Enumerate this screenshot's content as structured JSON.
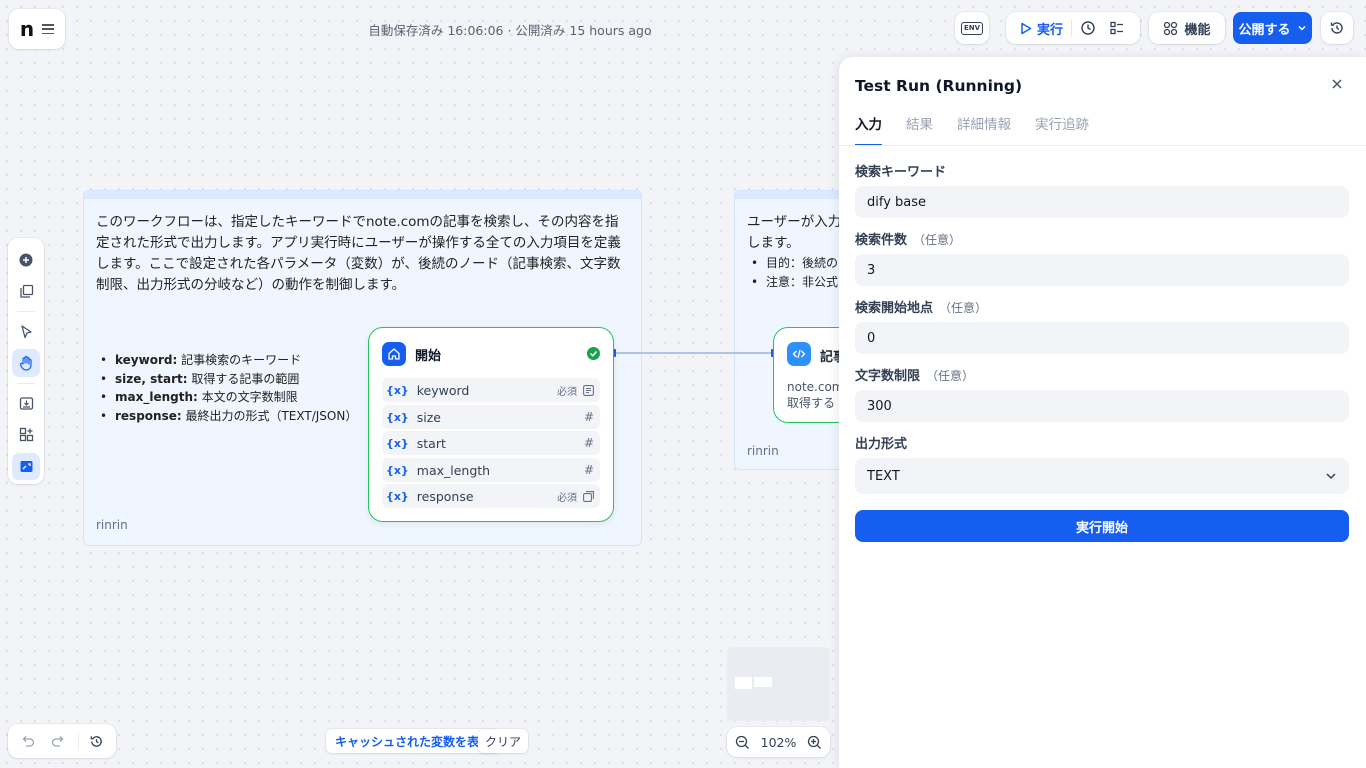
{
  "header": {
    "logo": "n",
    "status": "自動保存済み 16:06:06 · 公開済み 15 hours ago"
  },
  "toolbar": {
    "env_label": "ENV",
    "run_label": "実行",
    "features_label": "機能",
    "publish_label": "公開する",
    "accent": "#155eef"
  },
  "left_tools": [
    "add-node-icon",
    "add-note-icon",
    "pointer-icon",
    "hand-icon",
    "export-image-icon",
    "organize-icon",
    "minimap-toggle-icon"
  ],
  "note1": {
    "text": "このワークフローは、指定したキーワードでnote.comの記事を検索し、その内容を指定された形式で出力します。アプリ実行時にユーザーが操作する全ての入力項目を定義します。ここで設定された各パラメータ（変数）が、後続のノード（記事検索、文字数制限、出力形式の分岐など）の動作を制御します。",
    "items": [
      {
        "key": "keyword:",
        "desc": " 記事検索のキーワード"
      },
      {
        "key": "size, start:",
        "desc": " 取得する記事の範囲"
      },
      {
        "key": "max_length:",
        "desc": " 本文の文字数制限"
      },
      {
        "key": "response:",
        "desc": " 最終出力の形式（TEXT/JSON）"
      }
    ],
    "author": "rinrin"
  },
  "note2": {
    "text": "ユーザーが入力し",
    "text2": "します。",
    "items": [
      "目的：後続の",
      "注意：非公式"
    ],
    "author": "rinrin"
  },
  "start_node": {
    "title": "開始",
    "vars": [
      {
        "name": "keyword",
        "required": "必須",
        "type": "text-icon"
      },
      {
        "name": "size",
        "required": "",
        "type": "#"
      },
      {
        "name": "start",
        "required": "",
        "type": "#"
      },
      {
        "name": "max_length",
        "required": "",
        "type": "#"
      },
      {
        "name": "response",
        "required": "必須",
        "type": "select-icon"
      }
    ],
    "var_prefix": "{x}"
  },
  "node2": {
    "title": "記事",
    "desc1": "note.com",
    "desc2": "取得する"
  },
  "panel": {
    "title": "Test Run (Running)",
    "tabs": [
      "入力",
      "結果",
      "詳細情報",
      "実行追跡"
    ],
    "active_tab": "入力",
    "fields": [
      {
        "label": "検索キーワード",
        "optional": "",
        "value": "dify base"
      },
      {
        "label": "検索件数",
        "optional": "（任意）",
        "value": "3"
      },
      {
        "label": "検索開始地点",
        "optional": "（任意）",
        "value": "0"
      },
      {
        "label": "文字数制限",
        "optional": "（任意）",
        "value": "300"
      }
    ],
    "select": {
      "label": "出力形式",
      "value": "TEXT"
    },
    "submit_label": "実行開始"
  },
  "bottom": {
    "cache_label": "キャッシュされた変数を表示",
    "clear_label": "クリア",
    "zoom": "102%"
  }
}
